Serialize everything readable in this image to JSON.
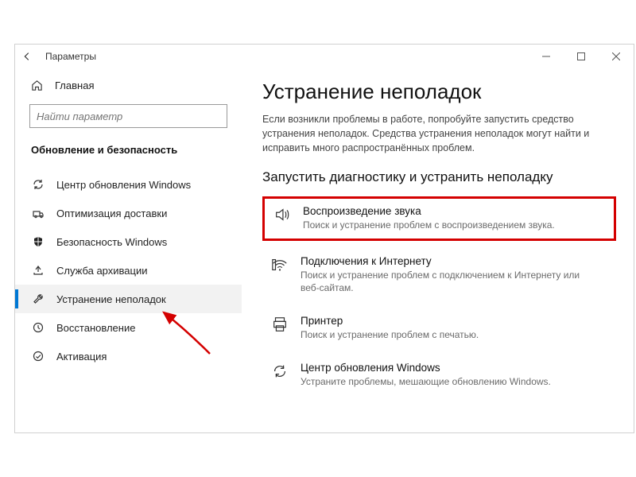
{
  "window": {
    "title": "Параметры"
  },
  "sidebar": {
    "home_label": "Главная",
    "search_placeholder": "Найти параметр",
    "section_label": "Обновление и безопасность",
    "items": [
      {
        "label": "Центр обновления Windows"
      },
      {
        "label": "Оптимизация доставки"
      },
      {
        "label": "Безопасность Windows"
      },
      {
        "label": "Служба архивации"
      },
      {
        "label": "Устранение неполадок"
      },
      {
        "label": "Восстановление"
      },
      {
        "label": "Активация"
      }
    ]
  },
  "main": {
    "title": "Устранение неполадок",
    "intro": "Если возникли проблемы в работе, попробуйте запустить средство устранения неполадок. Средства устранения неполадок могут найти и исправить много распространённых проблем.",
    "subhead": "Запустить диагностику и устранить неполадку",
    "items": [
      {
        "title": "Воспроизведение звука",
        "desc": "Поиск и устранение проблем с воспроизведением звука."
      },
      {
        "title": "Подключения к Интернету",
        "desc": "Поиск и устранение проблем с подключением к Интернету или веб-сайтам."
      },
      {
        "title": "Принтер",
        "desc": "Поиск и устранение проблем с печатью."
      },
      {
        "title": "Центр обновления Windows",
        "desc": "Устраните проблемы, мешающие обновлению Windows."
      }
    ]
  }
}
